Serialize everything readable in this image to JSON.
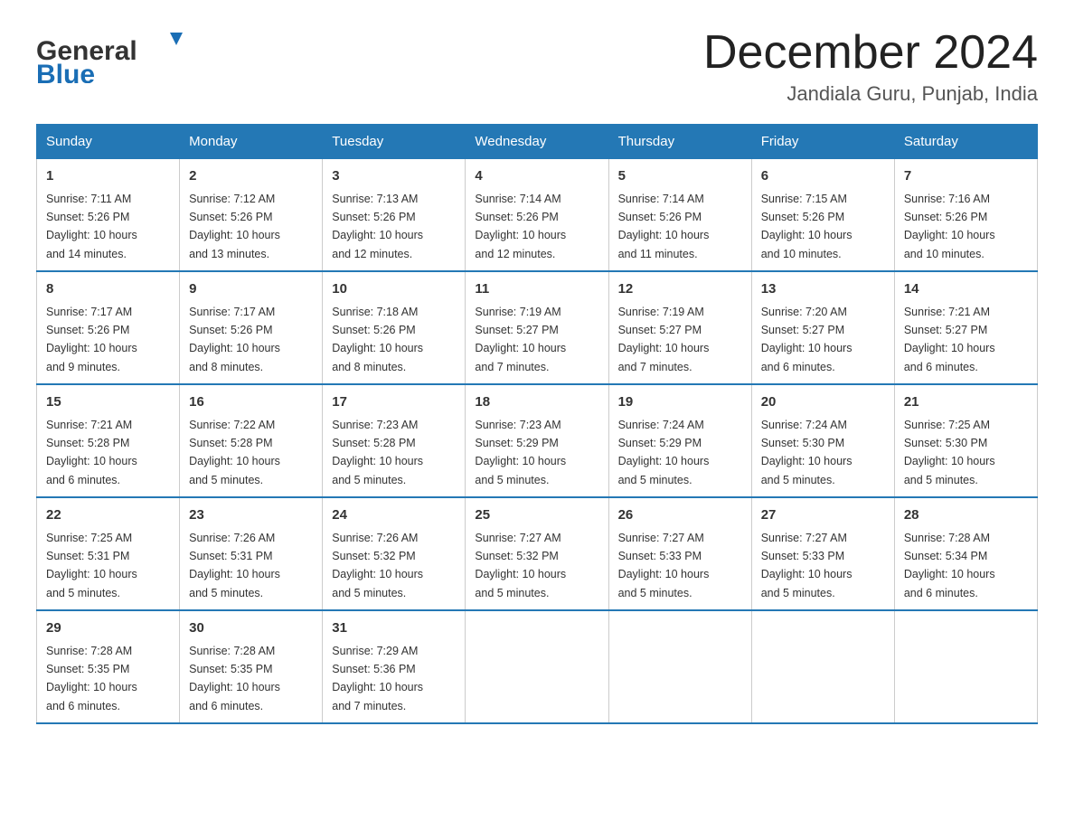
{
  "header": {
    "month_title": "December 2024",
    "subtitle": "Jandiala Guru, Punjab, India"
  },
  "logo": {
    "line1": "General",
    "line2": "Blue"
  },
  "days_header": [
    "Sunday",
    "Monday",
    "Tuesday",
    "Wednesday",
    "Thursday",
    "Friday",
    "Saturday"
  ],
  "weeks": [
    [
      {
        "num": "1",
        "sunrise": "7:11 AM",
        "sunset": "5:26 PM",
        "daylight": "10 hours and 14 minutes."
      },
      {
        "num": "2",
        "sunrise": "7:12 AM",
        "sunset": "5:26 PM",
        "daylight": "10 hours and 13 minutes."
      },
      {
        "num": "3",
        "sunrise": "7:13 AM",
        "sunset": "5:26 PM",
        "daylight": "10 hours and 12 minutes."
      },
      {
        "num": "4",
        "sunrise": "7:14 AM",
        "sunset": "5:26 PM",
        "daylight": "10 hours and 12 minutes."
      },
      {
        "num": "5",
        "sunrise": "7:14 AM",
        "sunset": "5:26 PM",
        "daylight": "10 hours and 11 minutes."
      },
      {
        "num": "6",
        "sunrise": "7:15 AM",
        "sunset": "5:26 PM",
        "daylight": "10 hours and 10 minutes."
      },
      {
        "num": "7",
        "sunrise": "7:16 AM",
        "sunset": "5:26 PM",
        "daylight": "10 hours and 10 minutes."
      }
    ],
    [
      {
        "num": "8",
        "sunrise": "7:17 AM",
        "sunset": "5:26 PM",
        "daylight": "10 hours and 9 minutes."
      },
      {
        "num": "9",
        "sunrise": "7:17 AM",
        "sunset": "5:26 PM",
        "daylight": "10 hours and 8 minutes."
      },
      {
        "num": "10",
        "sunrise": "7:18 AM",
        "sunset": "5:26 PM",
        "daylight": "10 hours and 8 minutes."
      },
      {
        "num": "11",
        "sunrise": "7:19 AM",
        "sunset": "5:27 PM",
        "daylight": "10 hours and 7 minutes."
      },
      {
        "num": "12",
        "sunrise": "7:19 AM",
        "sunset": "5:27 PM",
        "daylight": "10 hours and 7 minutes."
      },
      {
        "num": "13",
        "sunrise": "7:20 AM",
        "sunset": "5:27 PM",
        "daylight": "10 hours and 6 minutes."
      },
      {
        "num": "14",
        "sunrise": "7:21 AM",
        "sunset": "5:27 PM",
        "daylight": "10 hours and 6 minutes."
      }
    ],
    [
      {
        "num": "15",
        "sunrise": "7:21 AM",
        "sunset": "5:28 PM",
        "daylight": "10 hours and 6 minutes."
      },
      {
        "num": "16",
        "sunrise": "7:22 AM",
        "sunset": "5:28 PM",
        "daylight": "10 hours and 5 minutes."
      },
      {
        "num": "17",
        "sunrise": "7:23 AM",
        "sunset": "5:28 PM",
        "daylight": "10 hours and 5 minutes."
      },
      {
        "num": "18",
        "sunrise": "7:23 AM",
        "sunset": "5:29 PM",
        "daylight": "10 hours and 5 minutes."
      },
      {
        "num": "19",
        "sunrise": "7:24 AM",
        "sunset": "5:29 PM",
        "daylight": "10 hours and 5 minutes."
      },
      {
        "num": "20",
        "sunrise": "7:24 AM",
        "sunset": "5:30 PM",
        "daylight": "10 hours and 5 minutes."
      },
      {
        "num": "21",
        "sunrise": "7:25 AM",
        "sunset": "5:30 PM",
        "daylight": "10 hours and 5 minutes."
      }
    ],
    [
      {
        "num": "22",
        "sunrise": "7:25 AM",
        "sunset": "5:31 PM",
        "daylight": "10 hours and 5 minutes."
      },
      {
        "num": "23",
        "sunrise": "7:26 AM",
        "sunset": "5:31 PM",
        "daylight": "10 hours and 5 minutes."
      },
      {
        "num": "24",
        "sunrise": "7:26 AM",
        "sunset": "5:32 PM",
        "daylight": "10 hours and 5 minutes."
      },
      {
        "num": "25",
        "sunrise": "7:27 AM",
        "sunset": "5:32 PM",
        "daylight": "10 hours and 5 minutes."
      },
      {
        "num": "26",
        "sunrise": "7:27 AM",
        "sunset": "5:33 PM",
        "daylight": "10 hours and 5 minutes."
      },
      {
        "num": "27",
        "sunrise": "7:27 AM",
        "sunset": "5:33 PM",
        "daylight": "10 hours and 5 minutes."
      },
      {
        "num": "28",
        "sunrise": "7:28 AM",
        "sunset": "5:34 PM",
        "daylight": "10 hours and 6 minutes."
      }
    ],
    [
      {
        "num": "29",
        "sunrise": "7:28 AM",
        "sunset": "5:35 PM",
        "daylight": "10 hours and 6 minutes."
      },
      {
        "num": "30",
        "sunrise": "7:28 AM",
        "sunset": "5:35 PM",
        "daylight": "10 hours and 6 minutes."
      },
      {
        "num": "31",
        "sunrise": "7:29 AM",
        "sunset": "5:36 PM",
        "daylight": "10 hours and 7 minutes."
      },
      null,
      null,
      null,
      null
    ]
  ],
  "labels": {
    "sunrise": "Sunrise:",
    "sunset": "Sunset:",
    "daylight": "Daylight:"
  }
}
